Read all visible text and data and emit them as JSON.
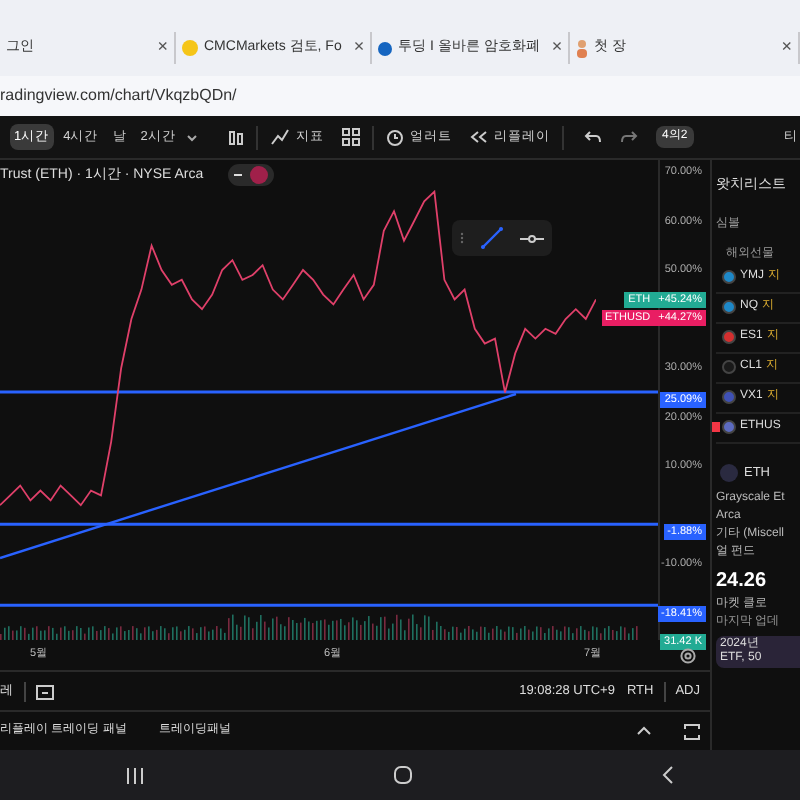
{
  "browser": {
    "tabs": [
      {
        "title": "그인",
        "kind": "plain",
        "close": "×"
      },
      {
        "title": "CMCMarkets 검토, Fo",
        "kind": "coin",
        "close": "×"
      },
      {
        "title": "투딩 I 올바른 암호화폐",
        "kind": "letter",
        "close": "×"
      },
      {
        "title": "첫 장",
        "kind": "person",
        "close": "×"
      }
    ],
    "address": "radingview.com/chart/VkqzbQDn/"
  },
  "toolbar": {
    "intervals": [
      {
        "label": "1시간",
        "selected": true
      },
      {
        "label": "4시간",
        "selected": false
      },
      {
        "label": "날",
        "selected": false
      },
      {
        "label": "2시간",
        "selected": false
      }
    ],
    "indicators": "지표",
    "alerts": "얼러트",
    "replay": "리플레이",
    "layout_badge": "4의2",
    "right_tab": "티"
  },
  "chart": {
    "title": "Trust (ETH) · 1시간 · NYSE Arca",
    "legend_on": true,
    "chart_data": {
      "type": "line",
      "ylim": [
        -25.5,
        72.45
      ],
      "ref_lines": [
        {
          "axis": "y",
          "value": 25.09,
          "color": "#2962ff"
        },
        {
          "axis": "y",
          "value": -1.88,
          "color": "#2962ff"
        },
        {
          "axis": "y",
          "value": -18.41,
          "color": "#2962ff"
        }
      ],
      "series": [
        {
          "name": "ETH",
          "color": "#e0406a",
          "values": [
            2,
            4,
            6,
            3,
            5,
            3,
            6,
            4,
            2,
            5,
            4,
            15,
            30,
            40,
            46,
            55,
            50,
            47,
            48,
            44,
            42,
            45,
            50,
            52,
            48,
            49,
            51,
            46,
            44,
            47,
            50,
            48,
            45,
            43,
            46,
            49,
            44,
            47,
            58,
            62,
            56,
            60,
            64,
            66,
            48,
            44,
            46,
            38,
            35,
            36,
            25,
            33,
            38,
            36,
            38,
            37,
            40,
            42,
            40,
            44
          ]
        }
      ],
      "yticks": [
        {
          "value": 70,
          "label": "70.00%"
        },
        {
          "value": 60,
          "label": "60.00%"
        },
        {
          "value": 50,
          "label": "50.00%"
        },
        {
          "value": 30,
          "label": "30.00%"
        },
        {
          "value": 20,
          "label": "20.00%"
        },
        {
          "value": 10,
          "label": "10.00%"
        },
        {
          "value": -10,
          "label": "-10.00%"
        }
      ]
    },
    "tags": [
      {
        "kind": "series",
        "value": "+45.24%",
        "color": "#22ab94"
      },
      {
        "label": "ETHUSD",
        "value": "+44.27%",
        "color": "#e91e63"
      },
      {
        "value": "25.09%",
        "color": "#2962ff"
      },
      {
        "value": "-1.88%",
        "color": "#2962ff"
      },
      {
        "value": "-18.41%",
        "color": "#2962ff"
      },
      {
        "value": "31.42 K",
        "color": "#22ab94"
      }
    ],
    "time_labels": [
      "5월",
      "6월",
      "7월"
    ]
  },
  "status_bar": {
    "left": "레",
    "time": "19:08:28 UTC+9",
    "session": "RTH",
    "adjust": "ADJ"
  },
  "bottom_tabs": [
    "리플레이 트레이딩 패널",
    "트레이딩패널"
  ],
  "watchlist": {
    "title": "왓치리스트",
    "column": "심볼",
    "group": "해외선물",
    "rows": [
      {
        "symbol": "YMJ",
        "badge": "지",
        "color": "#1e88c8",
        "flagged": false
      },
      {
        "symbol": "NQ",
        "badge": "지",
        "color": "#1e88c8",
        "flagged": false
      },
      {
        "symbol": "ES1",
        "badge": "지",
        "color": "#d32f2f",
        "flagged": false
      },
      {
        "symbol": "CL1",
        "badge": "지",
        "color": "#1a1a1a",
        "flagged": false
      },
      {
        "symbol": "VX1",
        "badge": "지",
        "color": "#3f51b5",
        "flagged": false
      },
      {
        "symbol": "ETHUS",
        "color": "#5c6bc0",
        "flagged": true
      }
    ]
  },
  "details": {
    "symbol": "ETH",
    "lines": [
      "Grayscale Et",
      "Arca",
      "기타 (Miscell",
      "얼 펀드"
    ],
    "price": "24.26",
    "status": "마켓 클로",
    "updated": "마지막 업데",
    "news": [
      "2024년",
      "ETF, 50"
    ]
  }
}
